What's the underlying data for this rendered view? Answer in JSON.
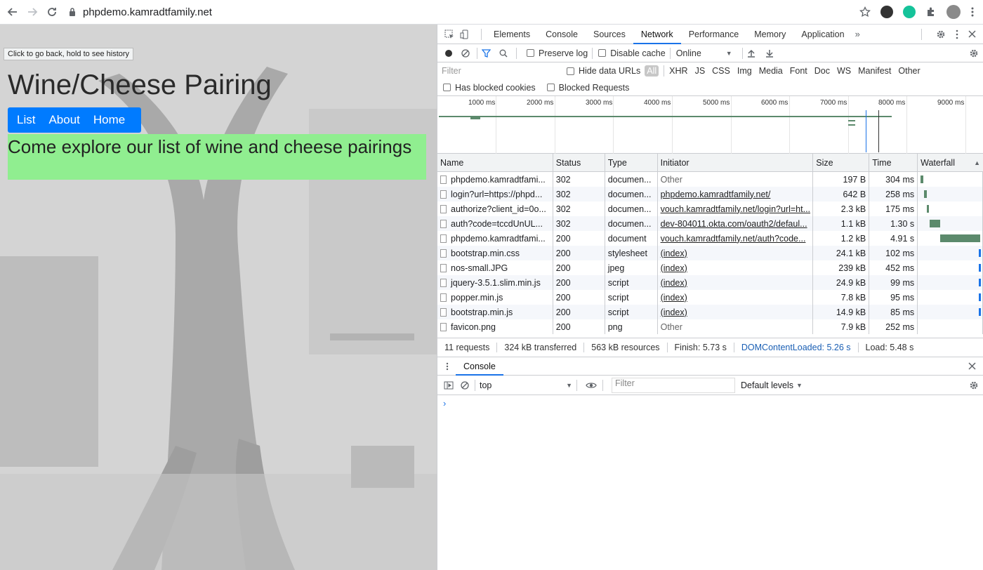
{
  "browser": {
    "url": "phpdemo.kamradtfamily.net"
  },
  "page": {
    "tooltip": "Click to go back, hold to see history",
    "title": "Wine/Cheese Pairing",
    "nav": [
      "List",
      "About",
      "Home"
    ],
    "banner": "Come explore our list of wine and cheese pairings"
  },
  "devtools": {
    "tabs": [
      "Elements",
      "Console",
      "Sources",
      "Network",
      "Performance",
      "Memory",
      "Application"
    ],
    "active_tab": "Network",
    "toolbar": {
      "preserve_log": "Preserve log",
      "disable_cache": "Disable cache",
      "throttle": "Online"
    },
    "filter": {
      "placeholder": "Filter",
      "hide_data_urls": "Hide data URLs",
      "types": [
        "All",
        "XHR",
        "JS",
        "CSS",
        "Img",
        "Media",
        "Font",
        "Doc",
        "WS",
        "Manifest",
        "Other"
      ],
      "has_blocked_cookies": "Has blocked cookies",
      "blocked_requests": "Blocked Requests"
    },
    "overview_ticks": [
      "1000 ms",
      "2000 ms",
      "3000 ms",
      "4000 ms",
      "5000 ms",
      "6000 ms",
      "7000 ms",
      "8000 ms",
      "9000 ms"
    ],
    "columns": [
      "Name",
      "Status",
      "Type",
      "Initiator",
      "Size",
      "Time",
      "Waterfall"
    ],
    "requests": [
      {
        "name": "phpdemo.kamradtfami...",
        "status": "302",
        "type": "documen...",
        "initiator": "Other",
        "initiator_kind": "other",
        "size": "197 B",
        "time": "304 ms",
        "wf_start": 0.0,
        "wf_len": 0.05
      },
      {
        "name": "login?url=https://phpd...",
        "status": "302",
        "type": "documen...",
        "initiator": "phpdemo.kamradtfamily.net/",
        "initiator_kind": "link",
        "size": "642 B",
        "time": "258 ms",
        "wf_start": 0.06,
        "wf_len": 0.04
      },
      {
        "name": "authorize?client_id=0o...",
        "status": "302",
        "type": "documen...",
        "initiator": "vouch.kamradtfamily.net/login?url=ht...",
        "initiator_kind": "link",
        "size": "2.3 kB",
        "time": "175 ms",
        "wf_start": 0.11,
        "wf_len": 0.03
      },
      {
        "name": "auth?code=tccdUnUL...",
        "status": "302",
        "type": "documen...",
        "initiator": "dev-804011.okta.com/oauth2/defaul...",
        "initiator_kind": "link",
        "size": "1.1 kB",
        "time": "1.30 s",
        "wf_start": 0.15,
        "wf_len": 0.18
      },
      {
        "name": "phpdemo.kamradtfami...",
        "status": "200",
        "type": "document",
        "initiator": "vouch.kamradtfamily.net/auth?code...",
        "initiator_kind": "link",
        "size": "1.2 kB",
        "time": "4.91 s",
        "wf_start": 0.33,
        "wf_len": 0.67
      },
      {
        "name": "bootstrap.min.css",
        "status": "200",
        "type": "stylesheet",
        "initiator": "(index)",
        "initiator_kind": "link",
        "size": "24.1 kB",
        "time": "102 ms",
        "wf_start": 0.98,
        "wf_len": 0.02
      },
      {
        "name": "nos-small.JPG",
        "status": "200",
        "type": "jpeg",
        "initiator": "(index)",
        "initiator_kind": "link",
        "size": "239 kB",
        "time": "452 ms",
        "wf_start": 0.98,
        "wf_len": 0.02
      },
      {
        "name": "jquery-3.5.1.slim.min.js",
        "status": "200",
        "type": "script",
        "initiator": "(index)",
        "initiator_kind": "link",
        "size": "24.9 kB",
        "time": "99 ms",
        "wf_start": 0.98,
        "wf_len": 0.02
      },
      {
        "name": "popper.min.js",
        "status": "200",
        "type": "script",
        "initiator": "(index)",
        "initiator_kind": "link",
        "size": "7.8 kB",
        "time": "95 ms",
        "wf_start": 0.98,
        "wf_len": 0.02
      },
      {
        "name": "bootstrap.min.js",
        "status": "200",
        "type": "script",
        "initiator": "(index)",
        "initiator_kind": "link",
        "size": "14.9 kB",
        "time": "85 ms",
        "wf_start": 0.98,
        "wf_len": 0.02
      },
      {
        "name": "favicon.png",
        "status": "200",
        "type": "png",
        "initiator": "Other",
        "initiator_kind": "other",
        "size": "7.9 kB",
        "time": "252 ms",
        "wf_start": 0.0,
        "wf_len": 0.0
      }
    ],
    "status_bar": {
      "requests": "11 requests",
      "transferred": "324 kB transferred",
      "resources": "563 kB resources",
      "finish": "Finish: 5.73 s",
      "domcontentloaded": "DOMContentLoaded: 5.26 s",
      "load": "Load: 5.48 s"
    },
    "console": {
      "tab": "Console",
      "context": "top",
      "filter_placeholder": "Filter",
      "levels": "Default levels",
      "prompt": "›"
    }
  },
  "colors": {
    "nav_bg": "#007bff",
    "banner_bg": "#90ee90",
    "active_tab": "#1a73e8",
    "waterfall_bar": "#5c8a6c"
  }
}
